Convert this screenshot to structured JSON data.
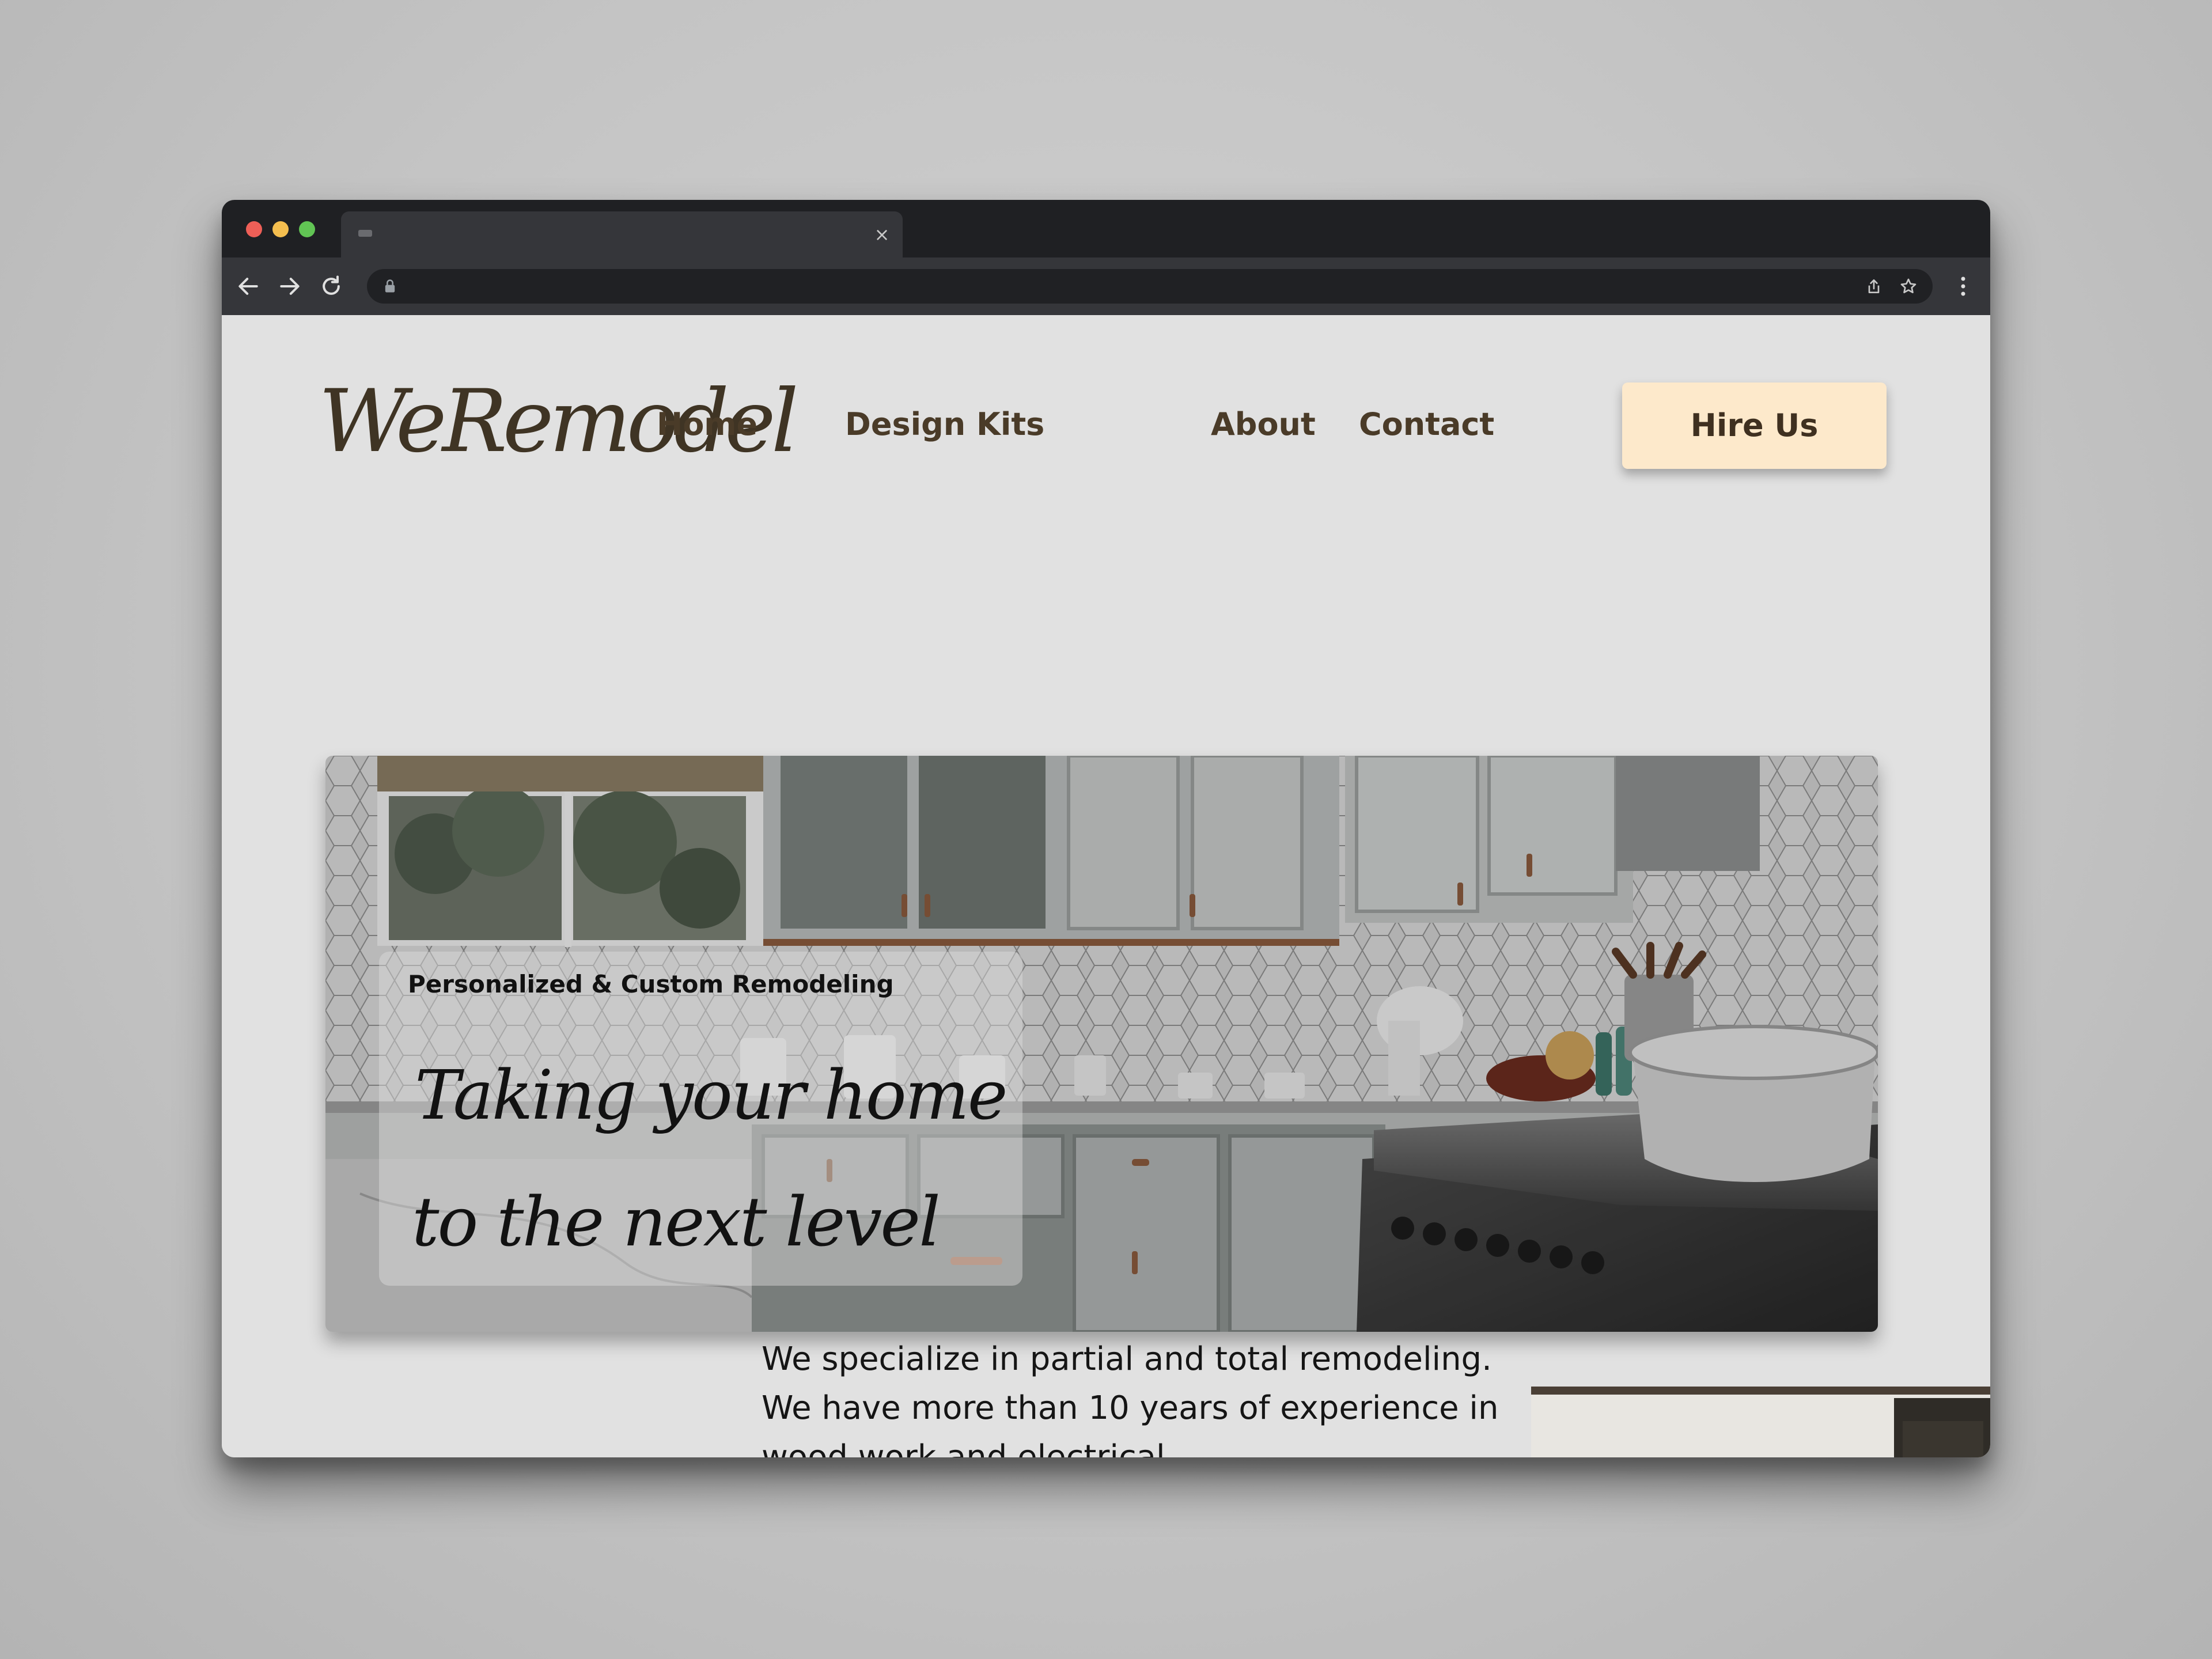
{
  "browser": {
    "tab_title": "",
    "tab_close": "×",
    "address": ""
  },
  "site": {
    "logo": "WeRemodel",
    "nav": [
      "Home",
      "Design Kits",
      "About",
      "Contact"
    ],
    "cta": "Hire Us"
  },
  "hero": {
    "eyebrow": "Personalized & Custom Remodeling",
    "headline_line1": "Taking your home",
    "headline_line2": "to the next level"
  },
  "about": {
    "text": "We specialize in partial and total remodeling. We have more than 10 years of experience in wood work and electrical"
  },
  "colors": {
    "brand_text": "#4a3b28",
    "cta_background": "#fde9cb",
    "page_background": "#e1e1e1",
    "browser_chrome": "#1f2023"
  },
  "icons": [
    "back-arrow-icon",
    "forward-arrow-icon",
    "reload-icon",
    "lock-icon",
    "share-icon",
    "star-icon",
    "more-vert-icon",
    "tab-close-icon"
  ]
}
